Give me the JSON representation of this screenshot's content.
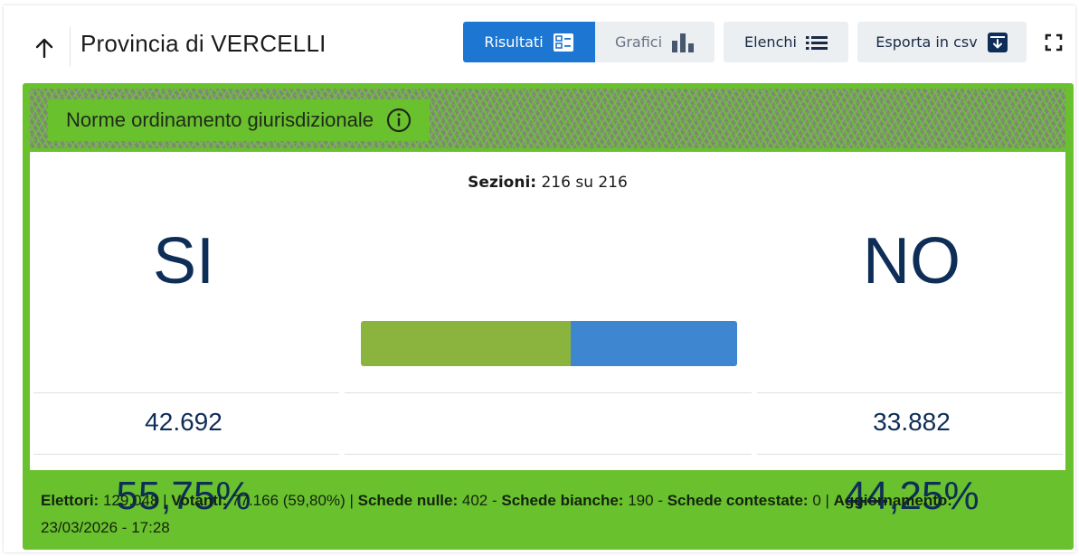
{
  "header": {
    "title": "Provincia di VERCELLI",
    "buttons": {
      "risultati": "Risultati",
      "grafici": "Grafici",
      "elenchi": "Elenchi",
      "esporta": "Esporta in csv"
    },
    "active_button_color": "#1c76d2"
  },
  "referendum": {
    "title": "Norme ordinamento giurisdizionale",
    "sections_label": "Sezioni:",
    "sections_value": "216 su 216",
    "yes": {
      "label": "SI",
      "votes": "42.692",
      "percent": "55,75%",
      "share": 0.5575,
      "color": "#8ab43e"
    },
    "no": {
      "label": "NO",
      "votes": "33.882",
      "percent": "44,25%",
      "share": 0.4425,
      "color": "#3e87d0"
    }
  },
  "footer": {
    "elettori_label": "Elettori:",
    "elettori_value": "129.048",
    "votanti_label": "Votanti:",
    "votanti_value": "77.166 (59,80%)",
    "nulle_label": "Schede nulle:",
    "nulle_value": "402",
    "bianche_label": "Schede bianche:",
    "bianche_value": "190",
    "contestate_label": "Schede contestate:",
    "contestate_value": "0",
    "aggiornamento_label": "Aggiornamento:",
    "aggiornamento_value": "23/03/2026 - 17:28"
  },
  "colors": {
    "panel_green": "#6ac12e",
    "text_navy": "#0e2e57"
  },
  "icons": [
    "arrow-up-icon",
    "results-icon",
    "bar-chart-icon",
    "list-icon",
    "archive-download-icon",
    "fullscreen-icon",
    "info-icon"
  ]
}
